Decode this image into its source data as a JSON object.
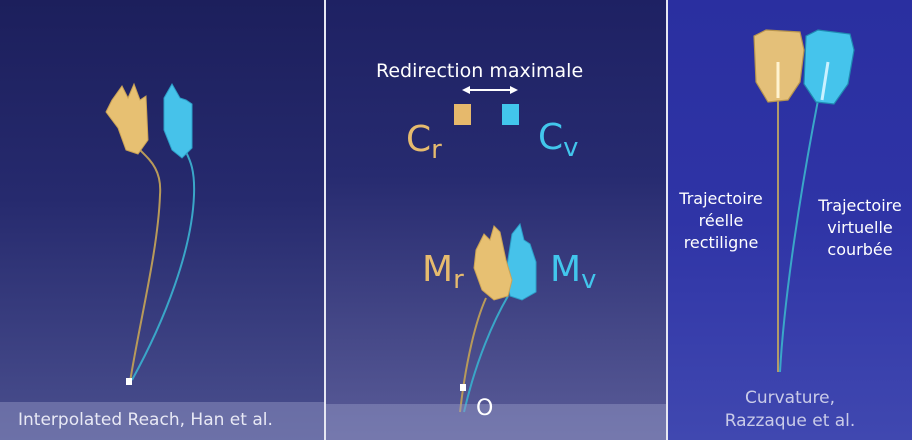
{
  "panels": {
    "left": {
      "caption": "Interpolated Reach, Han et al."
    },
    "middle": {
      "title": "Redirection maximale",
      "cr": {
        "main": "C",
        "sub": "r"
      },
      "cv": {
        "main": "C",
        "sub": "v"
      },
      "mr": {
        "main": "M",
        "sub": "r"
      },
      "mv": {
        "main": "M",
        "sub": "v"
      },
      "origin": "O"
    },
    "right": {
      "real_label_1": "Trajectoire",
      "real_label_2": "réelle",
      "real_label_3": "rectiligne",
      "virtual_label_1": "Trajectoire",
      "virtual_label_2": "virtuelle",
      "virtual_label_3": "courbée",
      "caption_line1": "Curvature,",
      "caption_line2": "Razzaque et al."
    }
  },
  "colors": {
    "real": "#e6bb6e",
    "virtual": "#42c6ec",
    "separator": "#e6e7f2"
  }
}
